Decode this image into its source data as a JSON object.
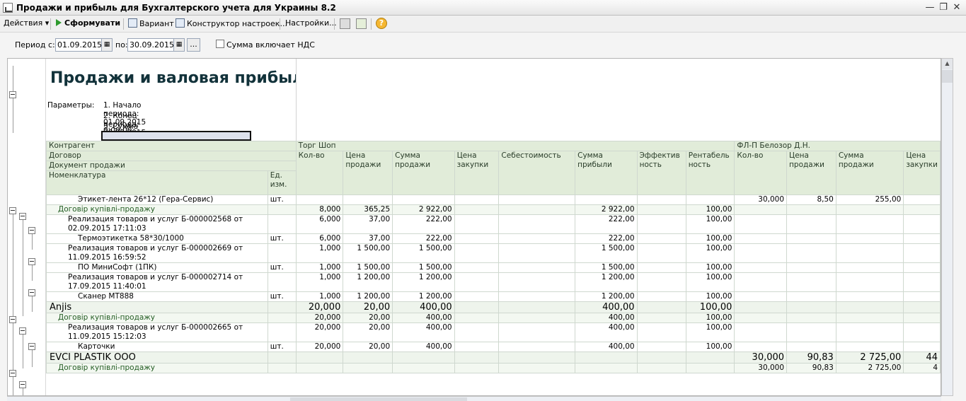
{
  "window": {
    "title": "Продажи и прибыль для Бухгалтерского учета для Украины 8.2",
    "icon": "report-window-icon"
  },
  "toolbar": {
    "actions": "Действия",
    "generate": "Сформувати",
    "variant": "Вариант",
    "builder": "Конструктор настроек...",
    "settings": "Настройки..."
  },
  "period": {
    "from_label": "Период с:",
    "from": "01.09.2015",
    "to_label": "по:",
    "to": "30.09.2015",
    "ellipsis": "...",
    "vat_label": "Сумма включает НДС",
    "vat_checked": false
  },
  "report": {
    "title": "Продажи и валовая прибыль",
    "params_label": "Параметры:",
    "params": [
      "1. Начало периода: 01.09.2015 0:00:00",
      "2. Конец периода: 30.09.2015 23:59:59",
      "3. Сумма включает НДС: Нет"
    ],
    "head": {
      "counterparty": "Контрагент",
      "contract": "Договор",
      "doc": "Документ продажи",
      "item": "Номенклатура",
      "unit": "Ед. изм."
    },
    "groups": [
      "Торг Шоп",
      "ФЛ-П Белозор Д.Н."
    ],
    "columns": [
      "Кол-во",
      "Цена продажи",
      "Сумма продажи",
      "Цена закупки",
      "Себестоимость",
      "Сумма прибыли",
      "Эффективность",
      "Рентабельность"
    ],
    "columns2": [
      "Кол-во",
      "Цена продажи",
      "Сумма продажи",
      "Цена закупки"
    ],
    "rows": [
      {
        "name": "Этикет-лента 26*12 (Гера-Сервис)",
        "unit": "шт.",
        "v": [
          "",
          "",
          "",
          "",
          "",
          "",
          "",
          ""
        ],
        "v2": [
          "30,000",
          "8,50",
          "255,00",
          ""
        ]
      },
      {
        "name": "Договір купівлі-продажу",
        "unit": "",
        "v": [
          "8,000",
          "365,25",
          "2 922,00",
          "",
          "",
          "2 922,00",
          "",
          "100,00"
        ],
        "v2": [
          "",
          "",
          "",
          ""
        ]
      },
      {
        "name": "Реализация товаров и услуг Б-000002568 от 02.09.2015 17:11:03",
        "unit": "",
        "v": [
          "6,000",
          "37,00",
          "222,00",
          "",
          "",
          "222,00",
          "",
          "100,00"
        ],
        "v2": [
          "",
          "",
          "",
          ""
        ]
      },
      {
        "name": "Термоэтикетка 58*30/1000",
        "unit": "шт.",
        "v": [
          "6,000",
          "37,00",
          "222,00",
          "",
          "",
          "222,00",
          "",
          "100,00"
        ],
        "v2": [
          "",
          "",
          "",
          ""
        ]
      },
      {
        "name": "Реализация товаров и услуг Б-000002669 от 11.09.2015 16:59:52",
        "unit": "",
        "v": [
          "1,000",
          "1 500,00",
          "1 500,00",
          "",
          "",
          "1 500,00",
          "",
          "100,00"
        ],
        "v2": [
          "",
          "",
          "",
          ""
        ]
      },
      {
        "name": "ПО МиниСофт (1ПК)",
        "unit": "шт.",
        "v": [
          "1,000",
          "1 500,00",
          "1 500,00",
          "",
          "",
          "1 500,00",
          "",
          "100,00"
        ],
        "v2": [
          "",
          "",
          "",
          ""
        ]
      },
      {
        "name": "Реализация товаров и услуг Б-000002714 от 17.09.2015 11:40:01",
        "unit": "",
        "v": [
          "1,000",
          "1 200,00",
          "1 200,00",
          "",
          "",
          "1 200,00",
          "",
          "100,00"
        ],
        "v2": [
          "",
          "",
          "",
          ""
        ]
      },
      {
        "name": "Сканер МТ888",
        "unit": "шт.",
        "v": [
          "1,000",
          "1 200,00",
          "1 200,00",
          "",
          "",
          "1 200,00",
          "",
          "100,00"
        ],
        "v2": [
          "",
          "",
          "",
          ""
        ]
      },
      {
        "name": "Anjis",
        "unit": "",
        "v": [
          "20,000",
          "20,00",
          "400,00",
          "",
          "",
          "400,00",
          "",
          "100,00"
        ],
        "v2": [
          "",
          "",
          "",
          ""
        ]
      },
      {
        "name": "Договір купівлі-продажу",
        "unit": "",
        "v": [
          "20,000",
          "20,00",
          "400,00",
          "",
          "",
          "400,00",
          "",
          "100,00"
        ],
        "v2": [
          "",
          "",
          "",
          ""
        ]
      },
      {
        "name": "Реализация товаров и услуг Б-000002665 от 11.09.2015 15:12:03",
        "unit": "",
        "v": [
          "20,000",
          "20,00",
          "400,00",
          "",
          "",
          "400,00",
          "",
          "100,00"
        ],
        "v2": [
          "",
          "",
          "",
          ""
        ]
      },
      {
        "name": "Карточки",
        "unit": "шт.",
        "v": [
          "20,000",
          "20,00",
          "400,00",
          "",
          "",
          "400,00",
          "",
          "100,00"
        ],
        "v2": [
          "",
          "",
          "",
          ""
        ]
      },
      {
        "name": "EVCI PLASTIK OOO",
        "unit": "",
        "v": [
          "",
          "",
          "",
          "",
          "",
          "",
          "",
          ""
        ],
        "v2": [
          "30,000",
          "90,83",
          "2 725,00",
          "44"
        ]
      },
      {
        "name": "Договір купівлі-продажу",
        "unit": "",
        "v": [
          "",
          "",
          "",
          "",
          "",
          "",
          "",
          ""
        ],
        "v2": [
          "30,000",
          "90,83",
          "2 725,00",
          "4"
        ]
      }
    ]
  }
}
